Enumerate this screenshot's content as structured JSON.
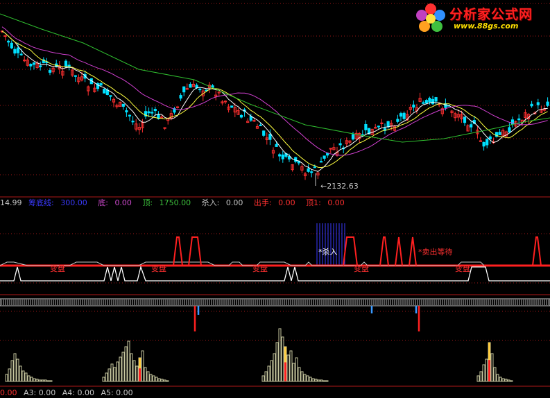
{
  "logo": {
    "title": "分析家公式网",
    "url": "www.88gs.com"
  },
  "price_panel": {
    "low_marker": "←2132.63"
  },
  "indicator_bar": {
    "value": "14.99",
    "items": [
      {
        "label": "筹底线:",
        "value": "300.00",
        "color": "#3a3aff"
      },
      {
        "label": "底:",
        "value": "0.00",
        "color": "#d04ad0"
      },
      {
        "label": "顶:",
        "value": "1750.00",
        "color": "#3cc03c"
      },
      {
        "label": "杀入:",
        "value": "0.00",
        "color": "#c8c8c8"
      },
      {
        "label": "出手:",
        "value": "0.00",
        "color": "#ff3030"
      },
      {
        "label": "顶1:",
        "value": "0.00",
        "color": "#ff3030"
      }
    ]
  },
  "signal_panel": {
    "labels": {
      "buy": "*杀入",
      "sell_wait": "*卖出等待",
      "watch": "变盘"
    }
  },
  "bottom_bar": {
    "items": [
      {
        "label": "0.00",
        "color": "#ff3030"
      },
      {
        "label": "A3: 0.00"
      },
      {
        "label": "A4: 0.00"
      },
      {
        "label": "A5: 0.00"
      }
    ]
  },
  "colors": {
    "up": "#ff3030",
    "down": "#00e0ff",
    "ma_fast": "#ffffff",
    "ma_mid": "#ffff40",
    "ma_pink": "#d040d0",
    "ma_green": "#30c030"
  }
}
